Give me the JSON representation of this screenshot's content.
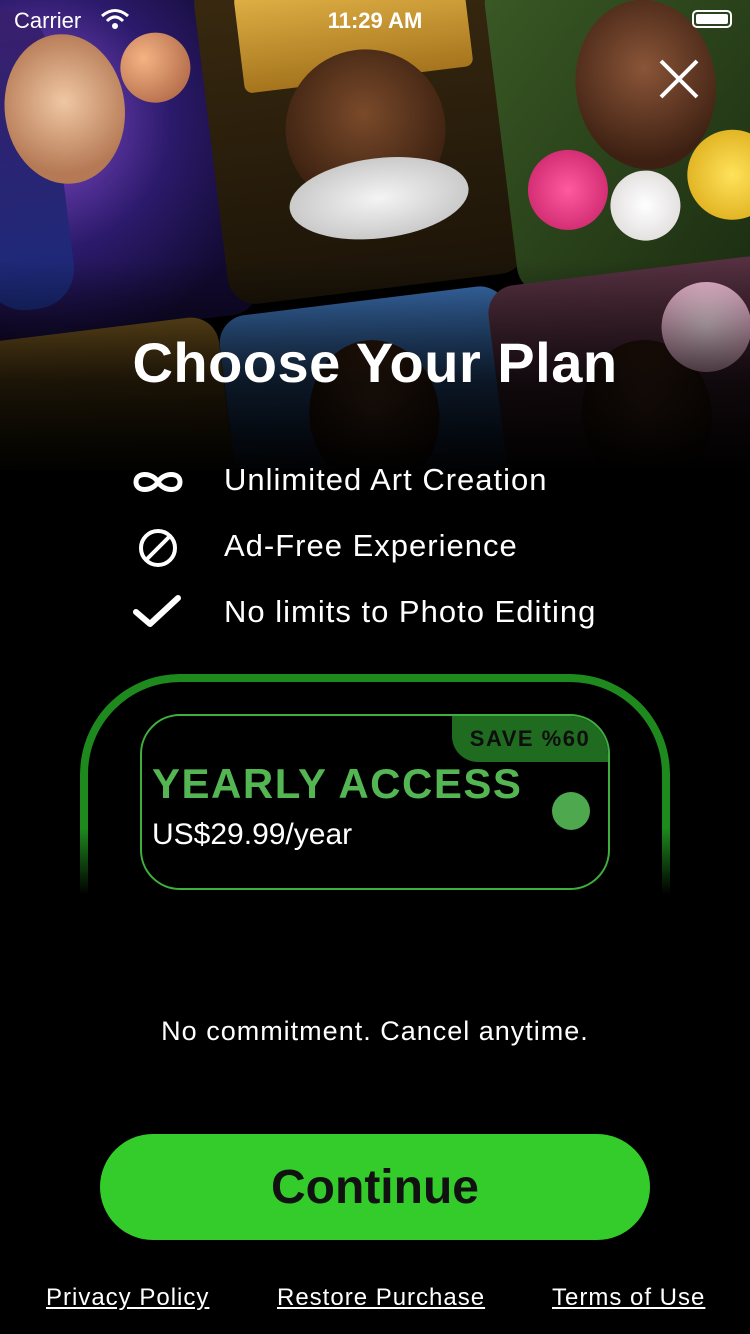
{
  "status_bar": {
    "carrier": "Carrier",
    "time": "11:29 AM"
  },
  "title": "Choose Your Plan",
  "features": [
    {
      "icon": "infinity-icon",
      "text": "Unlimited Art Creation"
    },
    {
      "icon": "no-ads-icon",
      "text": "Ad-Free Experience"
    },
    {
      "icon": "checkmark-icon",
      "text": "No limits to Photo Editing"
    }
  ],
  "plan": {
    "badge": "SAVE %60",
    "name": "YEARLY ACCESS",
    "price": "US$29.99/year",
    "selected": true
  },
  "commitment": "No commitment. Cancel anytime.",
  "continue_label": "Continue",
  "footer": {
    "privacy": "Privacy Policy",
    "restore": "Restore Purchase",
    "terms": "Terms of Use"
  },
  "colors": {
    "accent": "#33cc2b",
    "plan_text": "#53b653",
    "badge_bg": "#1f6b1f",
    "ring": "#1e8a1e"
  }
}
